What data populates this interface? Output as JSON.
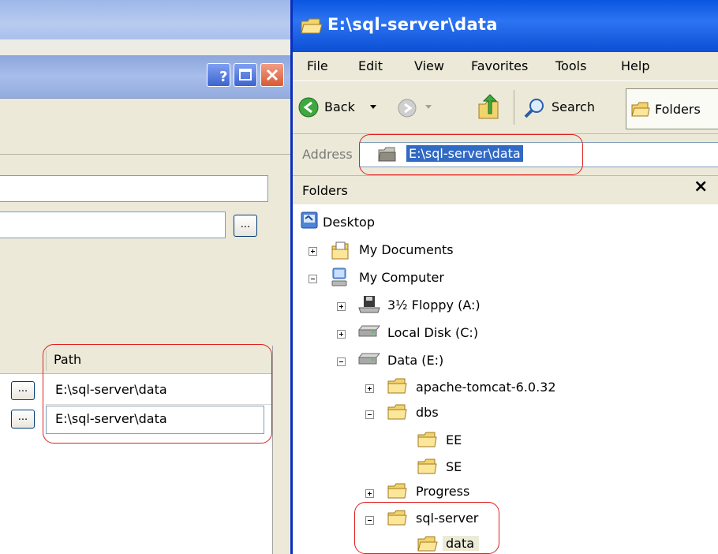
{
  "left_window": {
    "table": {
      "header_path": "Path",
      "rows": [
        {
          "browse": "...",
          "path": "E:\\sql-server\\data"
        },
        {
          "browse": "...",
          "path": "E:\\sql-server\\data"
        }
      ]
    },
    "browse_label": "..."
  },
  "explorer": {
    "title": "E:\\sql-server\\data",
    "menu": [
      "File",
      "Edit",
      "View",
      "Favorites",
      "Tools",
      "Help"
    ],
    "toolbar": {
      "back": "Back",
      "search": "Search",
      "folders": "Folders"
    },
    "address": {
      "label": "Address",
      "value": "E:\\sql-server\\data"
    },
    "folders_pane": {
      "title": "Folders",
      "close": "×"
    },
    "tree": [
      {
        "label": "Desktop"
      },
      {
        "label": "My Documents"
      },
      {
        "label": "My Computer"
      },
      {
        "label": "3½ Floppy (A:)"
      },
      {
        "label": "Local Disk (C:)"
      },
      {
        "label": "Data (E:)"
      },
      {
        "label": "apache-tomcat-6.0.32"
      },
      {
        "label": "dbs"
      },
      {
        "label": "EE"
      },
      {
        "label": "SE"
      },
      {
        "label": "Progress"
      },
      {
        "label": "sql-server"
      },
      {
        "label": "data"
      }
    ]
  },
  "colors": {
    "title_blue": "#0a56e0",
    "highlight": "#316ac5",
    "annotation_red": "#e02020"
  }
}
